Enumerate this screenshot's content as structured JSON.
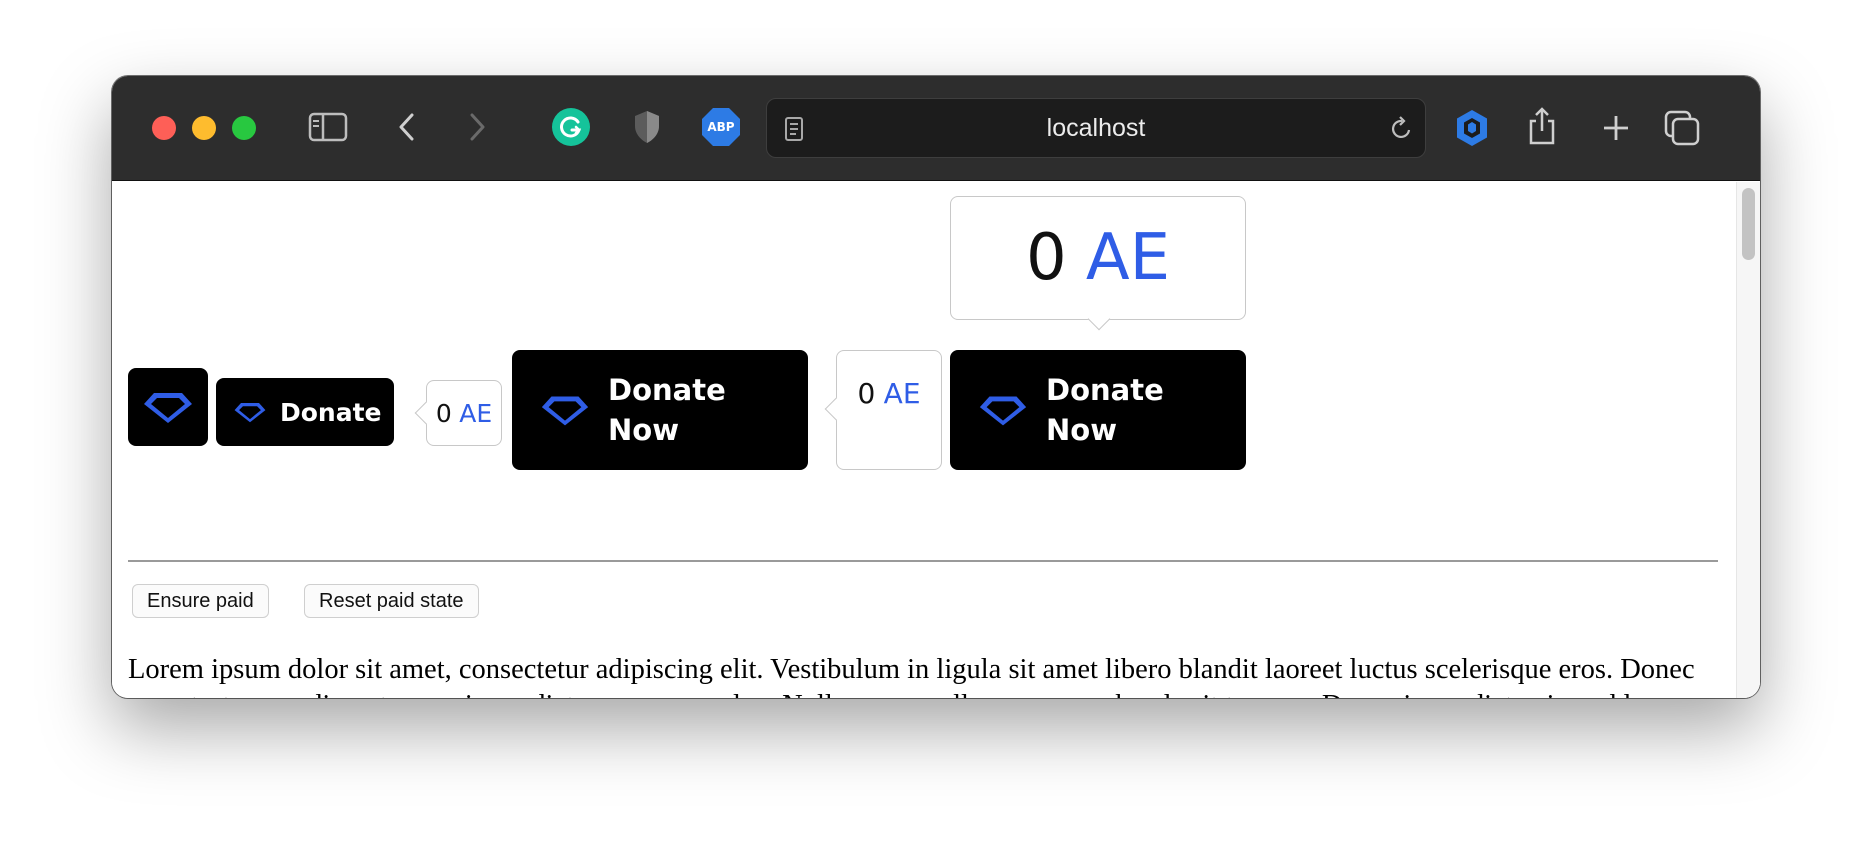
{
  "browser": {
    "url": "localhost",
    "extensions": [
      "grammarly-icon",
      "privacy-shield-icon",
      "adblock-plus-icon"
    ],
    "abp_label": "ABP"
  },
  "widgets": {
    "small_button_label": "Donate",
    "medium_button_label_line1": "Donate",
    "medium_button_label_line2": "Now",
    "large_button_label_line1": "Donate",
    "large_button_label_line2": "Now",
    "counter_small": {
      "amount": "0",
      "unit": "AE"
    },
    "counter_side": {
      "amount": "0",
      "unit": "AE"
    },
    "counter_top": {
      "amount": "0",
      "unit": "AE"
    }
  },
  "controls": {
    "ensure_paid": "Ensure paid",
    "reset_paid": "Reset paid state"
  },
  "body_text": "Lorem ipsum dolor sit amet, consectetur adipiscing elit. Vestibulum in ligula sit amet libero blandit laoreet luctus scelerisque eros. Donec nunc tortor, condimentum eu imperdiet ac, ornare ac leo. Nullam non nulla non massa hendrerit tempus. Donec imperdiet euismod lacus eu commodo. In pellentesque ipsum sed mi iaculis vestibulum. Mauris quis blandit est. Vestibulum posuere sit amet dui ultrices sollicitudin. Duis congue tincidunt metus, at dictum leo.",
  "colors": {
    "accent": "#2f5de6",
    "button_bg": "#000000",
    "toolbar_bg": "#2d2d2d"
  }
}
